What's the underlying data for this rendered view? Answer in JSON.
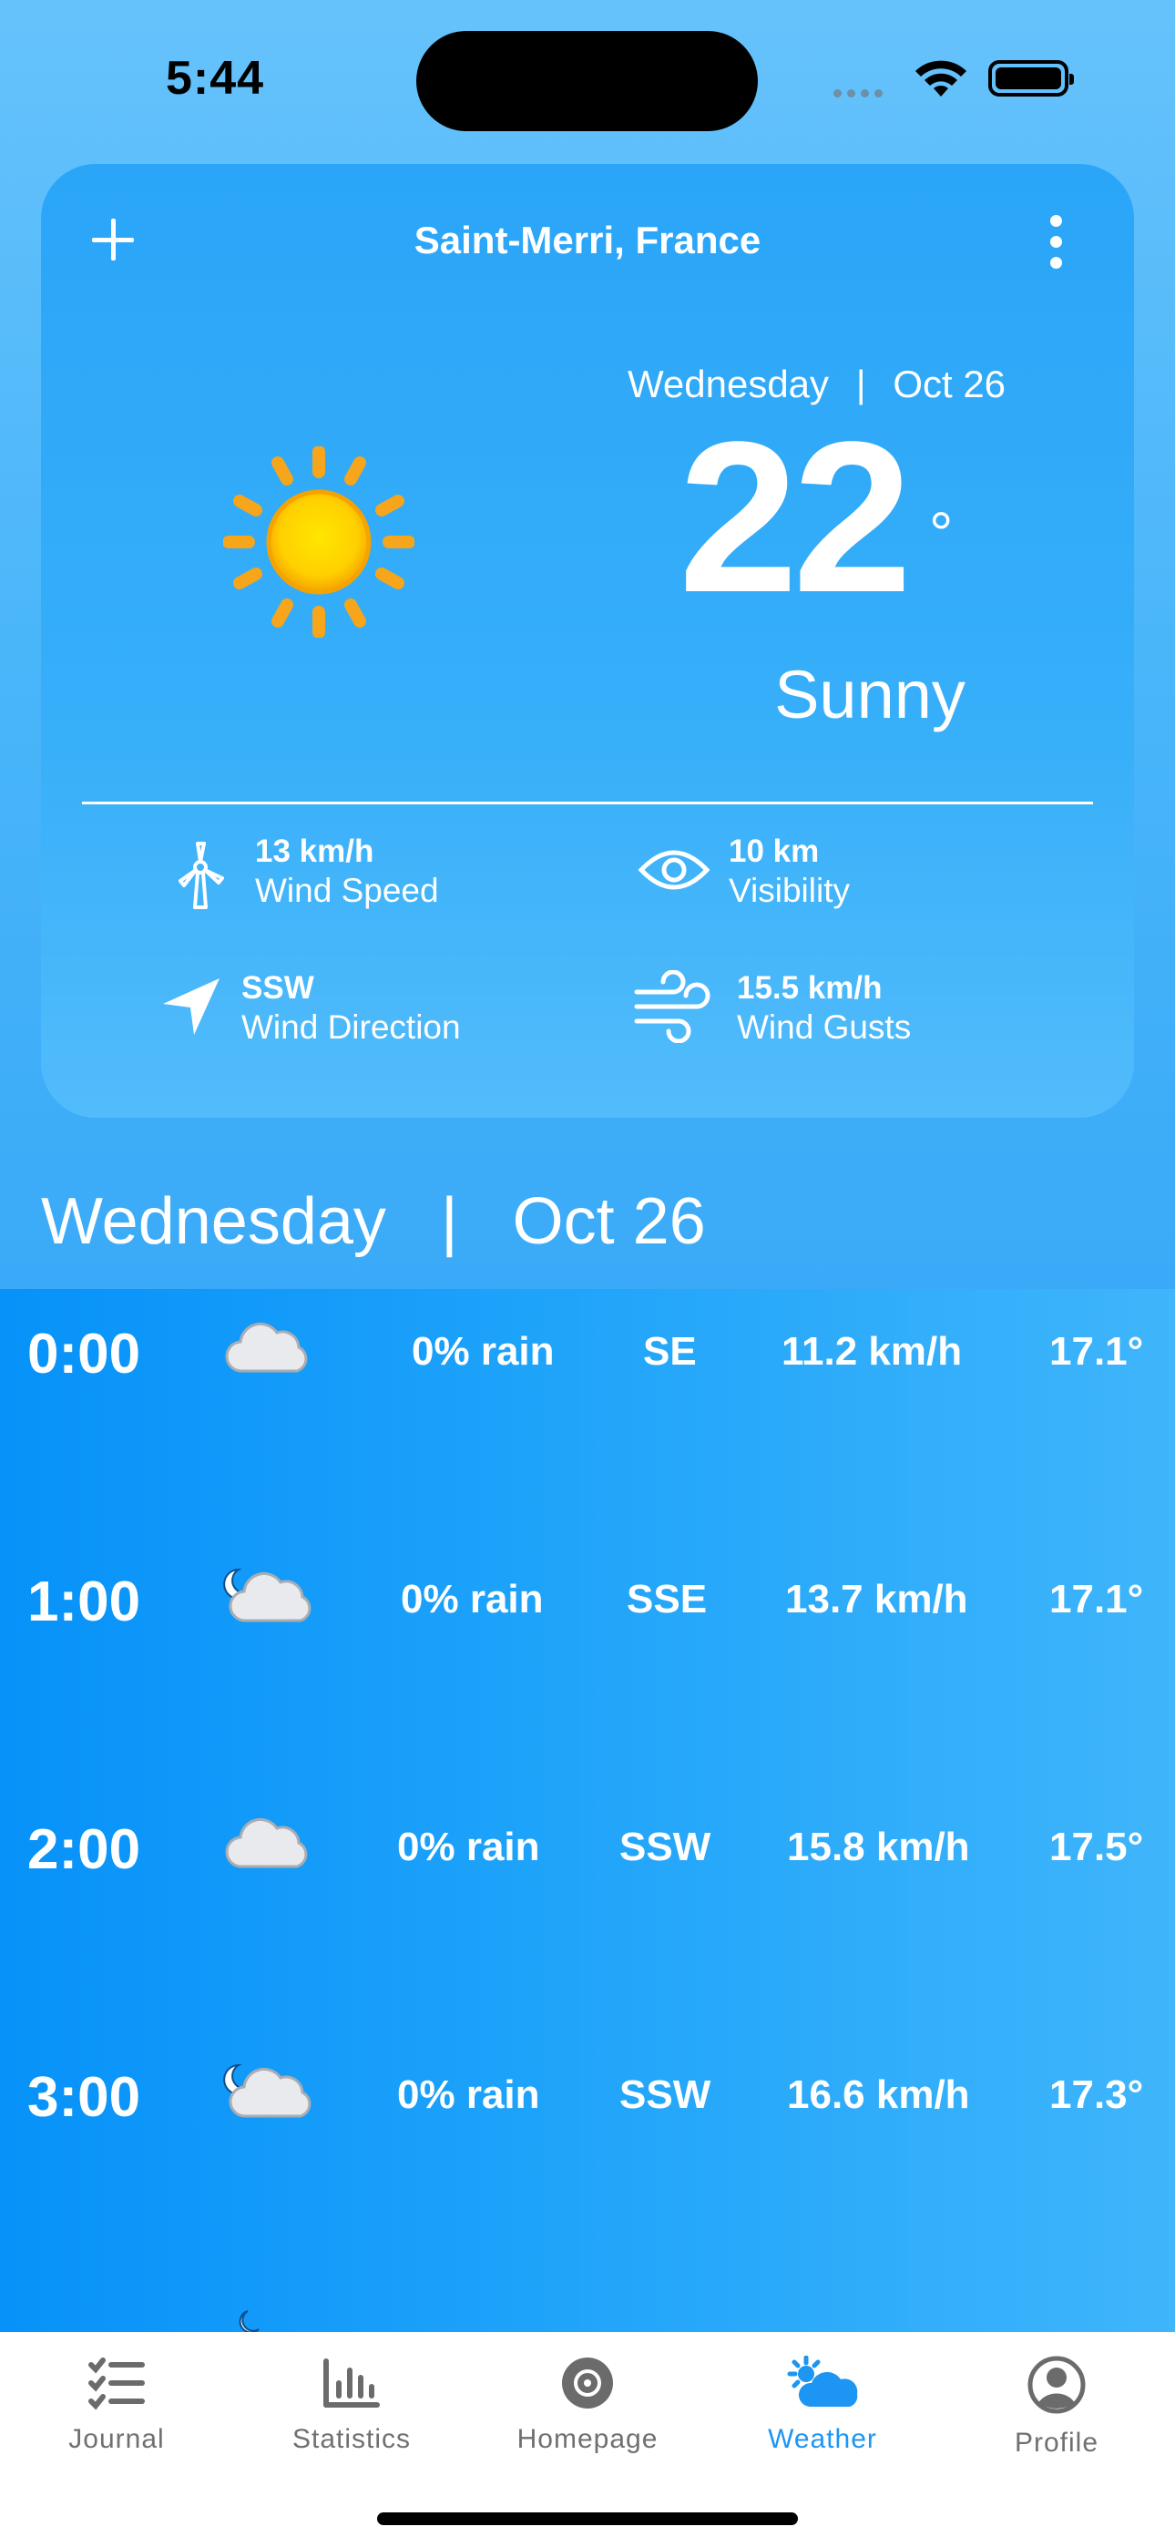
{
  "status": {
    "time": "5:44"
  },
  "card": {
    "location": "Saint-Merri, France",
    "day": "Wednesday",
    "separator": "|",
    "date": "Oct 26",
    "temperature": "22",
    "degree": "°",
    "condition": "Sunny",
    "condition_icon": "sun-icon",
    "stats": {
      "wind_speed": {
        "value": "13 km/h",
        "label": "Wind Speed",
        "icon": "wind-turbine-icon"
      },
      "visibility": {
        "value": "10 km",
        "label": "Visibility",
        "icon": "eye-icon"
      },
      "wind_direction": {
        "value": "SSW",
        "label": "Wind Direction",
        "icon": "navigation-arrow-icon"
      },
      "wind_gusts": {
        "value": "15.5 km/h",
        "label": "Wind Gusts",
        "icon": "wind-icon"
      }
    }
  },
  "day_header": {
    "day": "Wednesday",
    "separator": "|",
    "date": "Oct 26"
  },
  "hourly": [
    {
      "time": "0:00",
      "icon": "cloud-icon",
      "rain": "0% rain",
      "dir": "SE",
      "speed": "11.2 km/h",
      "temp": "17.1°"
    },
    {
      "time": "1:00",
      "icon": "cloud-moon-icon",
      "rain": "0% rain",
      "dir": "SSE",
      "speed": "13.7 km/h",
      "temp": "17.1°"
    },
    {
      "time": "2:00",
      "icon": "cloud-icon",
      "rain": "0% rain",
      "dir": "SSW",
      "speed": "15.8 km/h",
      "temp": "17.5°"
    },
    {
      "time": "3:00",
      "icon": "cloud-moon-icon",
      "rain": "0% rain",
      "dir": "SSW",
      "speed": "16.6 km/h",
      "temp": "17.3°"
    }
  ],
  "tabs": [
    {
      "label": "Journal",
      "icon": "checklist-icon"
    },
    {
      "label": "Statistics",
      "icon": "bar-chart-icon"
    },
    {
      "label": "Homepage",
      "icon": "target-icon"
    },
    {
      "label": "Weather",
      "icon": "sun-cloud-icon",
      "active": true
    },
    {
      "label": "Profile",
      "icon": "person-icon"
    }
  ],
  "colors": {
    "accent": "#1d95f2",
    "card": "#2aa5f8",
    "text_on_blue": "#ffffff"
  }
}
